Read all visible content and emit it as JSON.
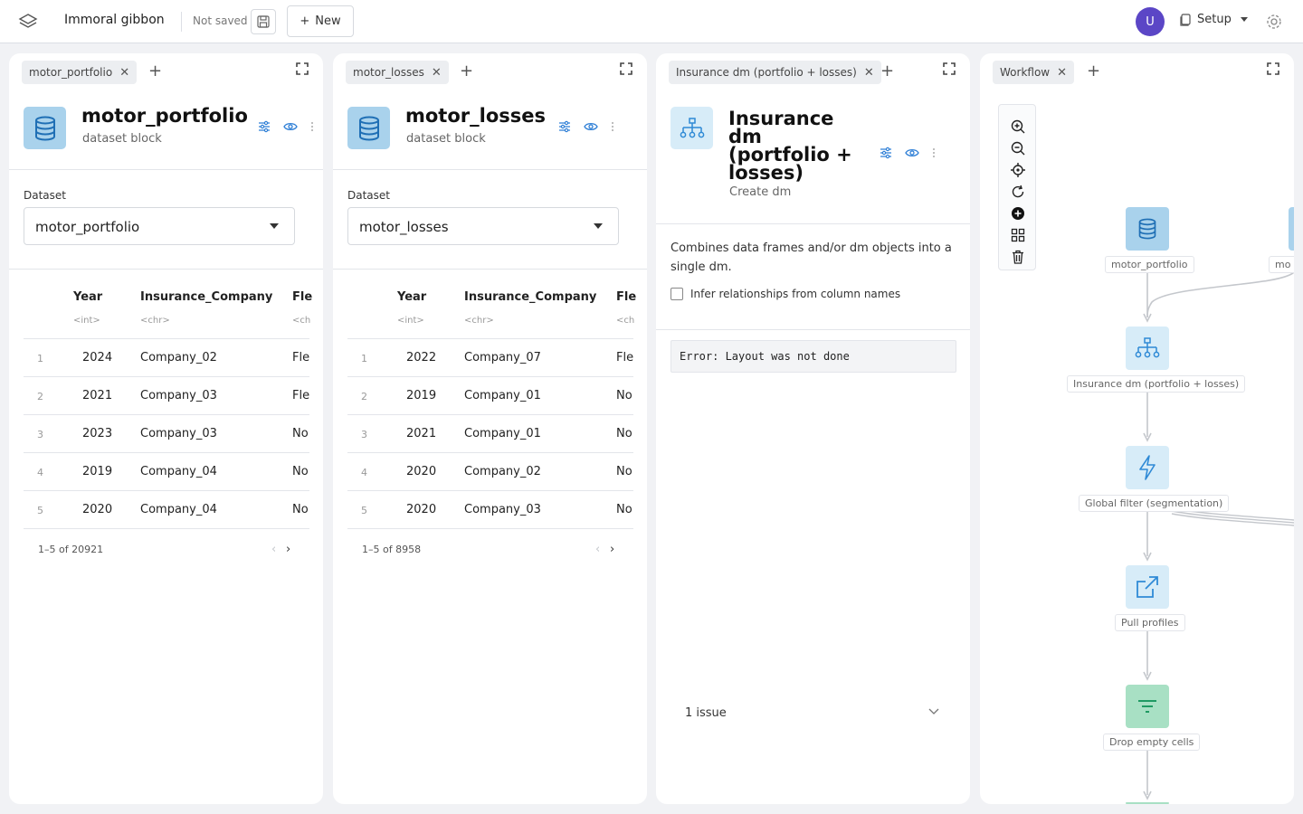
{
  "topbar": {
    "project_name": "Immoral gibbon",
    "save_status": "Not saved",
    "new_label": "New",
    "avatar_initial": "U",
    "setup_label": "Setup"
  },
  "panels": [
    {
      "tab": "motor_portfolio",
      "block_title": "motor_portfolio",
      "block_subtitle": "dataset block",
      "dataset_label": "Dataset",
      "dataset_value": "motor_portfolio",
      "columns": [
        {
          "name": "Year",
          "type": "<int>"
        },
        {
          "name": "Insurance_Company",
          "type": "<chr>"
        },
        {
          "name": "Fle",
          "type": "<ch"
        }
      ],
      "rows": [
        [
          "1",
          "2024",
          "Company_02",
          "Fle"
        ],
        [
          "2",
          "2021",
          "Company_03",
          "Fle"
        ],
        [
          "3",
          "2023",
          "Company_03",
          "No"
        ],
        [
          "4",
          "2019",
          "Company_04",
          "No"
        ],
        [
          "5",
          "2020",
          "Company_04",
          "No"
        ]
      ],
      "pager": "1–5 of 20921"
    },
    {
      "tab": "motor_losses",
      "block_title": "motor_losses",
      "block_subtitle": "dataset block",
      "dataset_label": "Dataset",
      "dataset_value": "motor_losses",
      "columns": [
        {
          "name": "Year",
          "type": "<int>"
        },
        {
          "name": "Insurance_Company",
          "type": "<chr>"
        },
        {
          "name": "Fle",
          "type": "<ch"
        }
      ],
      "rows": [
        [
          "1",
          "2022",
          "Company_07",
          "Fle"
        ],
        [
          "2",
          "2019",
          "Company_01",
          "No"
        ],
        [
          "3",
          "2021",
          "Company_01",
          "No"
        ],
        [
          "4",
          "2020",
          "Company_02",
          "No"
        ],
        [
          "5",
          "2020",
          "Company_03",
          "No"
        ]
      ],
      "pager": "1–5 of 8958"
    }
  ],
  "dm_panel": {
    "tab": "Insurance dm (portfolio + losses)",
    "title_lines": [
      "Insurance",
      "dm",
      "(portfolio +",
      "losses)"
    ],
    "subtitle": "Create dm",
    "description": "Combines data frames and/or dm objects into a single dm.",
    "checkbox_label": "Infer relationships from column names",
    "error": "Error: Layout was not done",
    "issues": "1 issue"
  },
  "workflow": {
    "tab": "Workflow",
    "nodes": [
      {
        "label": "motor_portfolio",
        "icon": "database-icon"
      },
      {
        "label": "mo",
        "icon": "database-icon"
      },
      {
        "label": "Insurance dm (portfolio + losses)",
        "icon": "hierarchy-icon"
      },
      {
        "label": "Global filter (segmentation)",
        "icon": "lightning-icon"
      },
      {
        "label": "Pull profiles",
        "icon": "external-link-icon"
      },
      {
        "label": "Drop empty cells",
        "icon": "filter-icon"
      }
    ]
  },
  "colors": {
    "accent": "#2f7fd6",
    "avatar": "#5b46c6",
    "dataset_icon_bg": "#a9d2ec",
    "filter_node_bg": "#a8e0c4"
  }
}
